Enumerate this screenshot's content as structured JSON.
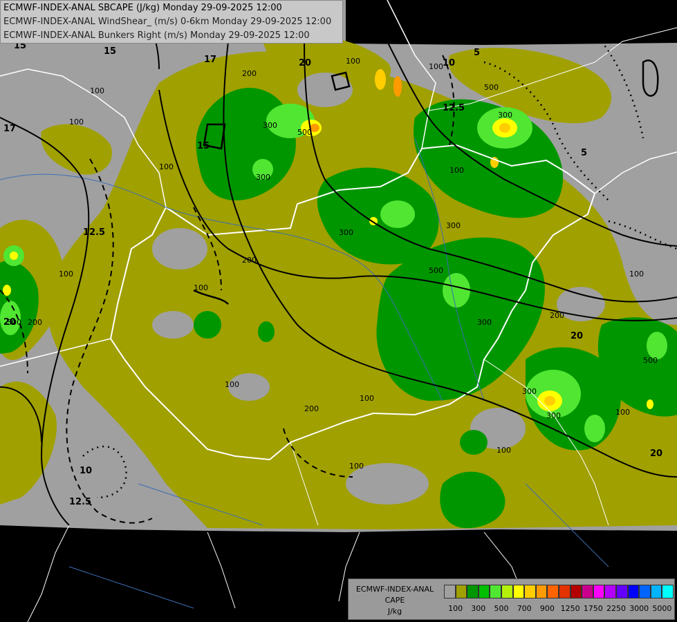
{
  "titles": {
    "line1": "ECMWF-INDEX-ANAL SBCAPE (J/kg) Monday 29-09-2025 12:00",
    "line2": "ECMWF-INDEX-ANAL WindShear_ (m/s) 0-6km Monday 29-09-2025 12:00",
    "line3": "ECMWF-INDEX-ANAL Bunkers Right (m/s) Monday 29-09-2025 12:00"
  },
  "legend": {
    "title1": "ECMWF-INDEX-ANAL",
    "title2": "CAPE",
    "title3": "J/kg",
    "colors": [
      "#a0a0a0",
      "#a0a000",
      "#009600",
      "#00be00",
      "#50e632",
      "#b4f00a",
      "#ffff00",
      "#ffcd00",
      "#ff9b00",
      "#ff6400",
      "#e13200",
      "#b40000",
      "#c8008c",
      "#ff00ff",
      "#b400ff",
      "#6400ff",
      "#0000ff",
      "#0064ff",
      "#00b4ff",
      "#00ffff",
      "#96ffff",
      "#ffffff"
    ],
    "ticks": [
      "100",
      "300",
      "500",
      "700",
      "900",
      "1250",
      "1750",
      "2250",
      "3000",
      "5000"
    ]
  },
  "map_labels": {
    "cape": [
      "100",
      "100",
      "100",
      "100",
      "100",
      "100",
      "100",
      "100",
      "100",
      "100",
      "100",
      "100",
      "100",
      "100",
      "300",
      "300",
      "300",
      "300",
      "300",
      "300",
      "300",
      "300",
      "300",
      "200",
      "200",
      "200",
      "200",
      "200",
      "500",
      "500",
      "500",
      "500"
    ],
    "shear": [
      "15",
      "15",
      "15",
      "17",
      "17",
      "12.5",
      "12.5",
      "12.5",
      "10",
      "10",
      "20",
      "20",
      "20",
      "20",
      "5",
      "5"
    ]
  },
  "colors": {
    "background": "#000000",
    "domain": "#a0a0a0",
    "cape_low": "#a0a000",
    "cape_green": "#009600",
    "cape_lightgreen": "#00be00",
    "border_white": "#ffffff",
    "contour": "#000000"
  }
}
